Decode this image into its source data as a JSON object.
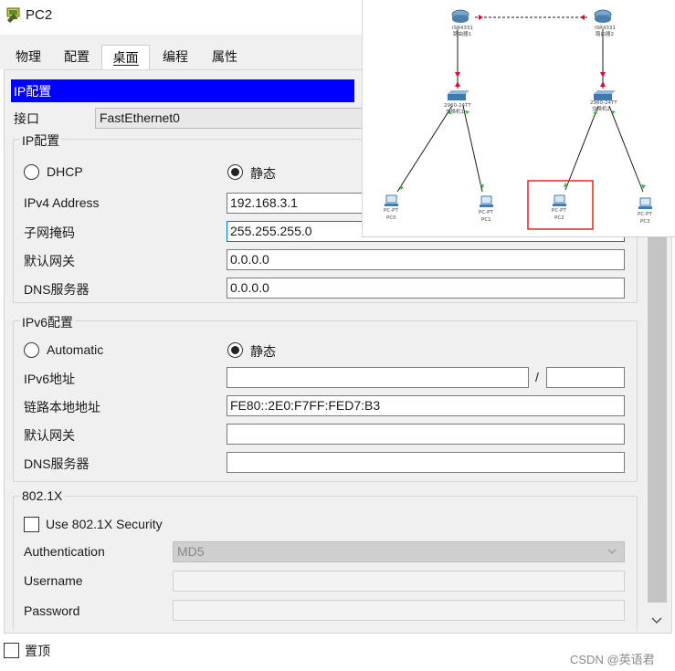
{
  "window": {
    "title": "PC2"
  },
  "tabs": [
    {
      "label": "物理",
      "active": false
    },
    {
      "label": "配置",
      "active": false
    },
    {
      "label": "桌面",
      "active": true
    },
    {
      "label": "编程",
      "active": false
    },
    {
      "label": "属性",
      "active": false
    }
  ],
  "ip_config": {
    "header": "IP配置",
    "interface_label": "接口",
    "interface_value": "FastEthernet0",
    "ipv4_group": {
      "title": "IP配置",
      "dhcp_label": "DHCP",
      "static_label": "静态",
      "selected": "static",
      "ipv4_address_label": "IPv4 Address",
      "ipv4_address_value": "192.168.3.1",
      "subnet_mask_label": "子网掩码",
      "subnet_mask_value": "255.255.255.0",
      "gateway_label": "默认网关",
      "gateway_value": "0.0.0.0",
      "dns_label": "DNS服务器",
      "dns_value": "0.0.0.0"
    },
    "ipv6_group": {
      "title": "IPv6配置",
      "automatic_label": "Automatic",
      "static_label": "静态",
      "selected": "static",
      "ipv6_address_label": "IPv6地址",
      "ipv6_address_value": "",
      "prefix_separator": "/",
      "prefix_value": "",
      "link_local_label": "链路本地地址",
      "link_local_value": "FE80::2E0:F7FF:FED7:B3",
      "gateway_label": "默认网关",
      "gateway_value": "",
      "dns_label": "DNS服务器",
      "dns_value": ""
    },
    "dot1x_group": {
      "title": "802.1X",
      "use_security_label": "Use 802.1X Security",
      "use_security_checked": false,
      "authentication_label": "Authentication",
      "authentication_value": "MD5",
      "username_label": "Username",
      "username_value": "",
      "password_label": "Password",
      "password_value": ""
    }
  },
  "footer": {
    "always_on_top_label": "置顶",
    "always_on_top_checked": false,
    "watermark": "CSDN @英语君"
  },
  "topology": {
    "routers": [
      {
        "model": "ISR4331",
        "name": "路由器1"
      },
      {
        "model": "ISR4331",
        "name": "路由器2"
      }
    ],
    "switches": [
      {
        "model": "2960-24TT",
        "name": "交换机1"
      },
      {
        "model": "2960-24TT",
        "name": "交换机2"
      }
    ],
    "pcs": [
      {
        "model": "PC-PT",
        "name": "PC0"
      },
      {
        "model": "PC-PT",
        "name": "PC1"
      },
      {
        "model": "PC-PT",
        "name": "PC2",
        "highlighted": true
      },
      {
        "model": "PC-PT",
        "name": "PC3"
      }
    ],
    "colors": {
      "link": "#1a1a1a",
      "up": "#3cb34a",
      "down": "#d8112b",
      "highlight": "#e0281e",
      "device": "#2b86c7"
    }
  },
  "colors": {
    "header_bg": "#0000ff",
    "panel_bg": "#f0f0f0"
  }
}
